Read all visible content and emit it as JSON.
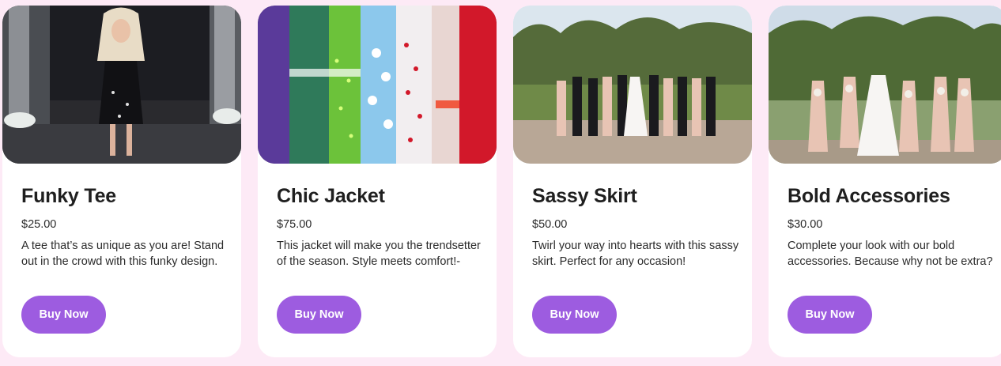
{
  "products": [
    {
      "title": "Funky Tee",
      "price": "$25.00",
      "description": "A tee that’s as unique as you are! Stand out in the crowd with this funky design.",
      "button": "Buy Now",
      "image_icon": "photo-woman-black-dress"
    },
    {
      "title": "Chic Jacket",
      "price": "$75.00",
      "description": "This jacket will make you the trendsetter of the season. Style meets comfort!-",
      "button": "Buy Now",
      "image_icon": "photo-colorful-dresses-rack"
    },
    {
      "title": "Sassy Skirt",
      "price": "$50.00",
      "description": "Twirl your way into hearts with this sassy skirt. Perfect for any occasion!",
      "button": "Buy Now",
      "image_icon": "photo-wedding-party-group"
    },
    {
      "title": "Bold Accessories",
      "price": "$30.00",
      "description": "Complete your look with our bold accessories. Because why not be extra?",
      "button": "Buy Now",
      "image_icon": "photo-bride-bridesmaids"
    }
  ],
  "colors": {
    "page_background": "#fdeaf6",
    "card_background": "#ffffff",
    "button_background": "#9d5ce0",
    "button_text": "#ffffff",
    "title_text": "#1f1f1f"
  }
}
